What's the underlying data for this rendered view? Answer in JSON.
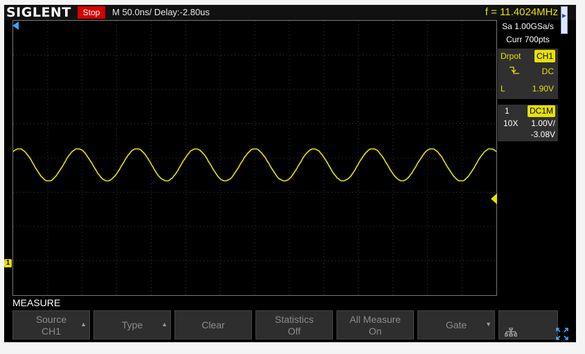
{
  "header": {
    "brand": "SIGLENT",
    "run_status": "Stop",
    "timebase_label": "M 50.0ns/  Delay:-2.80us",
    "frequency_readout": "f = 11.4024MHz"
  },
  "acquisition": {
    "sample_rate": "Sa 1.00GSa/s",
    "memory_depth": "Curr 700pts"
  },
  "trigger": {
    "mode": "Drpot",
    "source": "CH1",
    "slope_icon": "falling-edge-icon",
    "coupling": "DC",
    "level_label": "L",
    "level_value": "1.90V"
  },
  "channel1": {
    "number": "1",
    "coupling": "DC1M",
    "probe": "10X",
    "volts_per_div": "1.00V/",
    "offset": "-3.08V",
    "color": "#e8e000",
    "ground_marker": "1"
  },
  "waveform": {
    "cycles_on_screen": 8.2,
    "phase_start": 0.15,
    "center_division_y": 4.2,
    "amplitude_divisions": 0.47
  },
  "menu": {
    "title": "MEASURE",
    "softkeys": [
      {
        "line1": "Source",
        "line2": "CH1",
        "arrow": "▲"
      },
      {
        "line1": "Type",
        "line2": "",
        "arrow": "▲"
      },
      {
        "line1": "Clear",
        "line2": "",
        "arrow": ""
      },
      {
        "line1": "Statistics",
        "line2": "Off",
        "arrow": ""
      },
      {
        "line1": "All Measure",
        "line2": "On",
        "arrow": ""
      },
      {
        "line1": "Gate",
        "line2": "",
        "arrow": "▼"
      }
    ]
  },
  "colors": {
    "accent": "#e8e000",
    "stop": "#d40000",
    "trigger_marker": "#3aa6ff"
  }
}
